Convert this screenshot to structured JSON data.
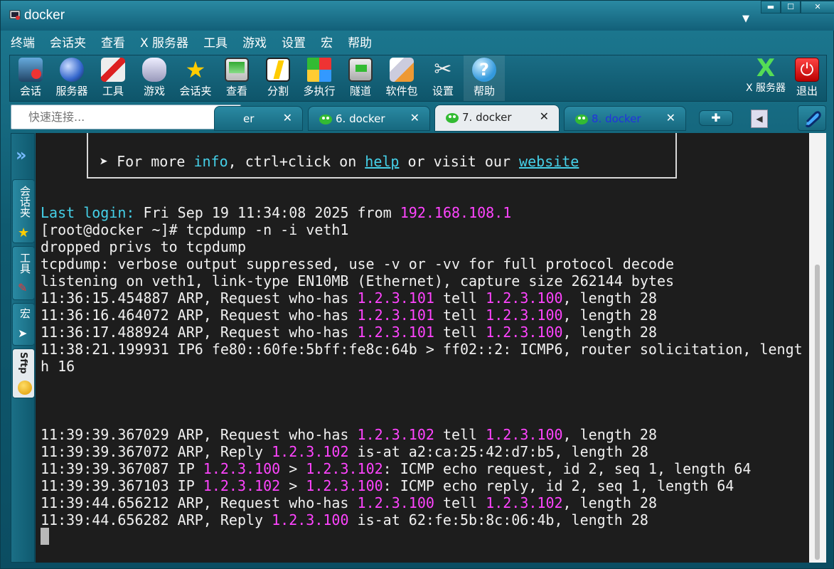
{
  "window": {
    "title": "docker"
  },
  "menu": [
    "终端",
    "会话夹",
    "查看",
    "X 服务器",
    "工具",
    "游戏",
    "设置",
    "宏",
    "帮助"
  ],
  "toolbar": {
    "items": [
      {
        "label": "会话",
        "icon": "session-icon"
      },
      {
        "label": "服务器",
        "icon": "server-globe-icon"
      },
      {
        "label": "工具",
        "icon": "tools-icon"
      },
      {
        "label": "游戏",
        "icon": "gamepad-icon"
      },
      {
        "label": "会话夹",
        "icon": "star-icon"
      },
      {
        "label": "查看",
        "icon": "monitor-icon"
      },
      {
        "label": "分割",
        "icon": "split-icon"
      },
      {
        "label": "多执行",
        "icon": "multi-exec-icon"
      },
      {
        "label": "隧道",
        "icon": "tunnel-icon"
      },
      {
        "label": "软件包",
        "icon": "packages-icon"
      },
      {
        "label": "设置",
        "icon": "settings-icon"
      },
      {
        "label": "帮助",
        "icon": "help-icon"
      }
    ],
    "xserver_label": "X 服务器",
    "exit_label": "退出"
  },
  "quick_connect": {
    "placeholder": "快速连接..."
  },
  "tabs": [
    {
      "label": "er",
      "close": "✕"
    },
    {
      "label": "6. docker",
      "close": "✕"
    },
    {
      "label": "7. docker",
      "close": "✕"
    },
    {
      "label": "8. docker",
      "close": "✕"
    }
  ],
  "side": {
    "expand": "»",
    "sessions": "会话夹",
    "tools": "工具",
    "macros": "宏",
    "sftp": "Sftp"
  },
  "terminal": {
    "banner": {
      "prefix": "➤ For more ",
      "info": "info",
      "mid1": ", ctrl+click on ",
      "help": "help",
      "mid2": " or visit our ",
      "website": "website"
    },
    "last_login": {
      "label": "Last login:",
      "text": " Fri Sep 19 11:34:08 2025 from ",
      "ip": "192.168.108.1"
    },
    "prompt_line": "[root@docker ~]# tcpdump -n -i veth1",
    "line_dropped": "dropped privs to tcpdump",
    "line_verbose": "tcpdump: verbose output suppressed, use -v or -vv for full protocol decode",
    "line_listening": "listening on veth1, link-type EN10MB (Ethernet), capture size 262144 bytes",
    "arp1": {
      "pre": "11:36:15.454887 ARP, Request who-has ",
      "ip1": "1.2.3.101",
      "mid": " tell ",
      "ip2": "1.2.3.100",
      "post": ", length 28"
    },
    "arp2": {
      "pre": "11:36:16.464072 ARP, Request who-has ",
      "ip1": "1.2.3.101",
      "mid": " tell ",
      "ip2": "1.2.3.100",
      "post": ", length 28"
    },
    "arp3": {
      "pre": "11:36:17.488924 ARP, Request who-has ",
      "ip1": "1.2.3.101",
      "mid": " tell ",
      "ip2": "1.2.3.100",
      "post": ", length 28"
    },
    "ip6_line1": "11:38:21.199931 IP6 fe80::60fe:5bff:fe8c:64b > ff02::2: ICMP6, router solicitation, lengt",
    "ip6_line2": "h 16",
    "arp4": {
      "pre": "11:39:39.367029 ARP, Request who-has ",
      "ip1": "1.2.3.102",
      "mid": " tell ",
      "ip2": "1.2.3.100",
      "post": ", length 28"
    },
    "reply1": {
      "pre": "11:39:39.367072 ARP, Reply ",
      "ip": "1.2.3.102",
      "post": " is-at a2:ca:25:42:d7:b5, length 28"
    },
    "icmp1": {
      "pre": "11:39:39.367087 IP ",
      "ip1": "1.2.3.100",
      "mid": " > ",
      "ip2": "1.2.3.102",
      "post": ": ICMP echo request, id 2, seq 1, length 64"
    },
    "icmp2": {
      "pre": "11:39:39.367103 IP ",
      "ip1": "1.2.3.102",
      "mid": " > ",
      "ip2": "1.2.3.100",
      "post": ": ICMP echo reply, id 2, seq 1, length 64"
    },
    "arp5": {
      "pre": "11:39:44.656212 ARP, Request who-has ",
      "ip1": "1.2.3.100",
      "mid": " tell ",
      "ip2": "1.2.3.102",
      "post": ", length 28"
    },
    "reply2": {
      "pre": "11:39:44.656282 ARP, Reply ",
      "ip": "1.2.3.100",
      "post": " is-at 62:fe:5b:8c:06:4b, length 28"
    }
  },
  "colors": {
    "terminal_bg": "#1d1d1d",
    "cyan": "#45d0e8",
    "magenta": "#ff44ff",
    "frame": "#0f5a70"
  }
}
